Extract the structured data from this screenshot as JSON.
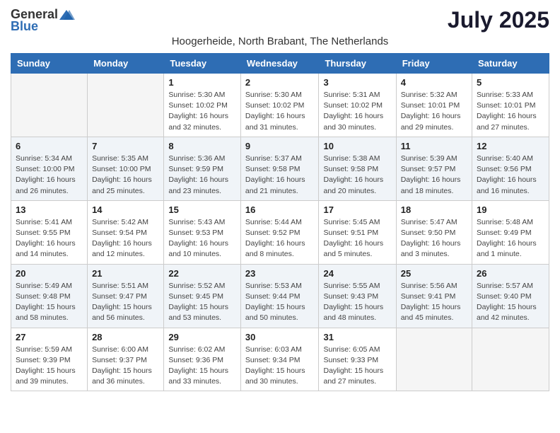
{
  "logo": {
    "general": "General",
    "blue": "Blue"
  },
  "title": "July 2025",
  "location": "Hoogerheide, North Brabant, The Netherlands",
  "headers": [
    "Sunday",
    "Monday",
    "Tuesday",
    "Wednesday",
    "Thursday",
    "Friday",
    "Saturday"
  ],
  "weeks": [
    [
      {
        "day": "",
        "detail": ""
      },
      {
        "day": "",
        "detail": ""
      },
      {
        "day": "1",
        "detail": "Sunrise: 5:30 AM\nSunset: 10:02 PM\nDaylight: 16 hours\nand 32 minutes."
      },
      {
        "day": "2",
        "detail": "Sunrise: 5:30 AM\nSunset: 10:02 PM\nDaylight: 16 hours\nand 31 minutes."
      },
      {
        "day": "3",
        "detail": "Sunrise: 5:31 AM\nSunset: 10:02 PM\nDaylight: 16 hours\nand 30 minutes."
      },
      {
        "day": "4",
        "detail": "Sunrise: 5:32 AM\nSunset: 10:01 PM\nDaylight: 16 hours\nand 29 minutes."
      },
      {
        "day": "5",
        "detail": "Sunrise: 5:33 AM\nSunset: 10:01 PM\nDaylight: 16 hours\nand 27 minutes."
      }
    ],
    [
      {
        "day": "6",
        "detail": "Sunrise: 5:34 AM\nSunset: 10:00 PM\nDaylight: 16 hours\nand 26 minutes."
      },
      {
        "day": "7",
        "detail": "Sunrise: 5:35 AM\nSunset: 10:00 PM\nDaylight: 16 hours\nand 25 minutes."
      },
      {
        "day": "8",
        "detail": "Sunrise: 5:36 AM\nSunset: 9:59 PM\nDaylight: 16 hours\nand 23 minutes."
      },
      {
        "day": "9",
        "detail": "Sunrise: 5:37 AM\nSunset: 9:58 PM\nDaylight: 16 hours\nand 21 minutes."
      },
      {
        "day": "10",
        "detail": "Sunrise: 5:38 AM\nSunset: 9:58 PM\nDaylight: 16 hours\nand 20 minutes."
      },
      {
        "day": "11",
        "detail": "Sunrise: 5:39 AM\nSunset: 9:57 PM\nDaylight: 16 hours\nand 18 minutes."
      },
      {
        "day": "12",
        "detail": "Sunrise: 5:40 AM\nSunset: 9:56 PM\nDaylight: 16 hours\nand 16 minutes."
      }
    ],
    [
      {
        "day": "13",
        "detail": "Sunrise: 5:41 AM\nSunset: 9:55 PM\nDaylight: 16 hours\nand 14 minutes."
      },
      {
        "day": "14",
        "detail": "Sunrise: 5:42 AM\nSunset: 9:54 PM\nDaylight: 16 hours\nand 12 minutes."
      },
      {
        "day": "15",
        "detail": "Sunrise: 5:43 AM\nSunset: 9:53 PM\nDaylight: 16 hours\nand 10 minutes."
      },
      {
        "day": "16",
        "detail": "Sunrise: 5:44 AM\nSunset: 9:52 PM\nDaylight: 16 hours\nand 8 minutes."
      },
      {
        "day": "17",
        "detail": "Sunrise: 5:45 AM\nSunset: 9:51 PM\nDaylight: 16 hours\nand 5 minutes."
      },
      {
        "day": "18",
        "detail": "Sunrise: 5:47 AM\nSunset: 9:50 PM\nDaylight: 16 hours\nand 3 minutes."
      },
      {
        "day": "19",
        "detail": "Sunrise: 5:48 AM\nSunset: 9:49 PM\nDaylight: 16 hours\nand 1 minute."
      }
    ],
    [
      {
        "day": "20",
        "detail": "Sunrise: 5:49 AM\nSunset: 9:48 PM\nDaylight: 15 hours\nand 58 minutes."
      },
      {
        "day": "21",
        "detail": "Sunrise: 5:51 AM\nSunset: 9:47 PM\nDaylight: 15 hours\nand 56 minutes."
      },
      {
        "day": "22",
        "detail": "Sunrise: 5:52 AM\nSunset: 9:45 PM\nDaylight: 15 hours\nand 53 minutes."
      },
      {
        "day": "23",
        "detail": "Sunrise: 5:53 AM\nSunset: 9:44 PM\nDaylight: 15 hours\nand 50 minutes."
      },
      {
        "day": "24",
        "detail": "Sunrise: 5:55 AM\nSunset: 9:43 PM\nDaylight: 15 hours\nand 48 minutes."
      },
      {
        "day": "25",
        "detail": "Sunrise: 5:56 AM\nSunset: 9:41 PM\nDaylight: 15 hours\nand 45 minutes."
      },
      {
        "day": "26",
        "detail": "Sunrise: 5:57 AM\nSunset: 9:40 PM\nDaylight: 15 hours\nand 42 minutes."
      }
    ],
    [
      {
        "day": "27",
        "detail": "Sunrise: 5:59 AM\nSunset: 9:39 PM\nDaylight: 15 hours\nand 39 minutes."
      },
      {
        "day": "28",
        "detail": "Sunrise: 6:00 AM\nSunset: 9:37 PM\nDaylight: 15 hours\nand 36 minutes."
      },
      {
        "day": "29",
        "detail": "Sunrise: 6:02 AM\nSunset: 9:36 PM\nDaylight: 15 hours\nand 33 minutes."
      },
      {
        "day": "30",
        "detail": "Sunrise: 6:03 AM\nSunset: 9:34 PM\nDaylight: 15 hours\nand 30 minutes."
      },
      {
        "day": "31",
        "detail": "Sunrise: 6:05 AM\nSunset: 9:33 PM\nDaylight: 15 hours\nand 27 minutes."
      },
      {
        "day": "",
        "detail": ""
      },
      {
        "day": "",
        "detail": ""
      }
    ]
  ]
}
